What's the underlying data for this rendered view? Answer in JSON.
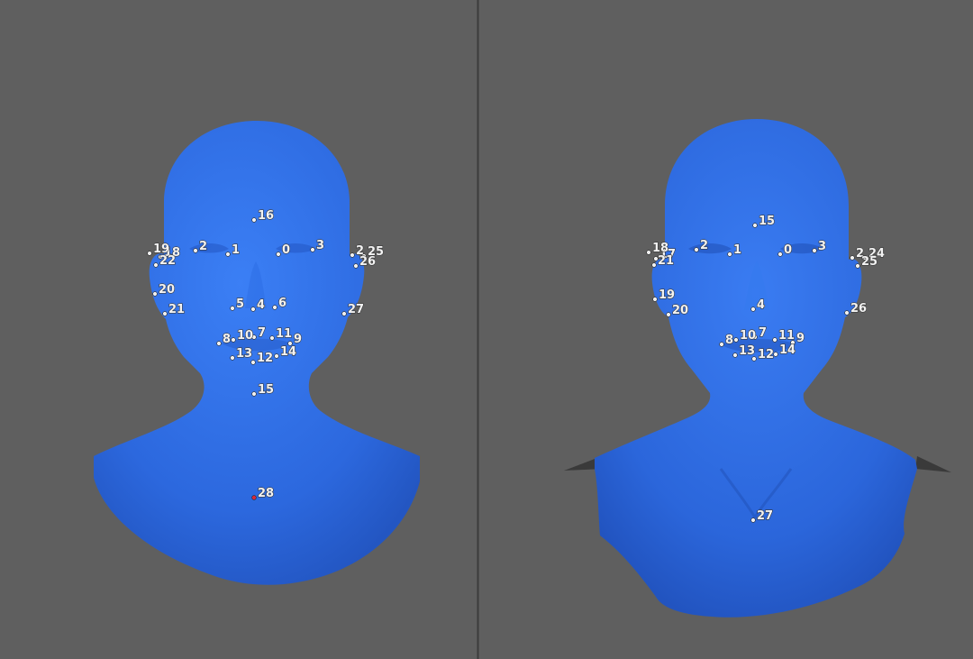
{
  "colors": {
    "background": "#5f5f5f",
    "divider": "#3c3c3c",
    "mesh": "#2f6fe6",
    "landmark": "#f0f0f0",
    "landmark_selected": "#d8283c"
  },
  "left_view": {
    "landmarks": [
      {
        "id": "0"
      },
      {
        "id": "1"
      },
      {
        "id": "2"
      },
      {
        "id": "3"
      },
      {
        "id": "4"
      },
      {
        "id": "5"
      },
      {
        "id": "6"
      },
      {
        "id": "7"
      },
      {
        "id": "8"
      },
      {
        "id": "9"
      },
      {
        "id": "10"
      },
      {
        "id": "11"
      },
      {
        "id": "12"
      },
      {
        "id": "13"
      },
      {
        "id": "14"
      },
      {
        "id": "15"
      },
      {
        "id": "16"
      },
      {
        "id": "18"
      },
      {
        "id": "19"
      },
      {
        "id": "20"
      },
      {
        "id": "21"
      },
      {
        "id": "22"
      },
      {
        "id": "2"
      },
      {
        "id": "25"
      },
      {
        "id": "26"
      },
      {
        "id": "27"
      },
      {
        "id": "28",
        "selected": true
      }
    ]
  },
  "right_view": {
    "landmarks": [
      {
        "id": "0"
      },
      {
        "id": "1"
      },
      {
        "id": "2"
      },
      {
        "id": "3"
      },
      {
        "id": "4"
      },
      {
        "id": "7"
      },
      {
        "id": "8"
      },
      {
        "id": "9"
      },
      {
        "id": "10"
      },
      {
        "id": "11"
      },
      {
        "id": "12"
      },
      {
        "id": "13"
      },
      {
        "id": "14"
      },
      {
        "id": "15"
      },
      {
        "id": "17"
      },
      {
        "id": "18"
      },
      {
        "id": "19"
      },
      {
        "id": "20"
      },
      {
        "id": "21"
      },
      {
        "id": "2"
      },
      {
        "id": "24"
      },
      {
        "id": "25"
      },
      {
        "id": "26"
      },
      {
        "id": "27"
      }
    ]
  }
}
